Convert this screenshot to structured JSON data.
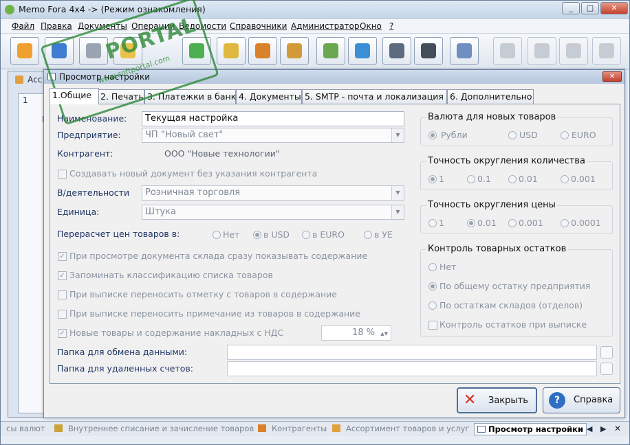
{
  "window": {
    "title": "Memo Fora 4x4 -> (Режим ознакомления)",
    "min": "_",
    "max": "□",
    "close": "✕"
  },
  "menu": [
    "Файл",
    "Правка",
    "Документы",
    "Операции",
    "Ведомости",
    "Справочники",
    "Администратор",
    "Окно",
    "?"
  ],
  "toolbar": {
    "icons": [
      "notes-icon",
      "card-icon",
      "printer-icon",
      "folder-icon",
      "download-icon",
      "scales-icon",
      "users-icon",
      "box-icon",
      "user-doc-icon",
      "chart-icon",
      "binoculars-icon",
      "headset-icon",
      "edit-icon",
      "tool1-icon",
      "tool2-icon",
      "tool3-icon",
      "tool4-icon"
    ]
  },
  "watermark": {
    "brand": "PORTAL",
    "url": "www.softportal.com"
  },
  "dialog": {
    "title": "Просмотр настройки",
    "close": "✕",
    "tabs": [
      "1.Общие",
      "2. Печать",
      "3. Платежки в банк",
      "4. Документы",
      "5. SMTP - почта и локализация",
      "6. Дополнительно"
    ],
    "fields": {
      "name_label": "Наименование:",
      "name_value": "Текущая настройка",
      "enterprise_label": "Предприятие:",
      "enterprise_value": "ЧП \"Новый свет\"",
      "contractor_label": "Контрагент:",
      "contractor_value": "ООО \"Новые технологии\"",
      "create_without_contractor": "Создавать новый документ без указания контрагента",
      "activity_label": "В/деятельности",
      "activity_value": "Розничная торговля",
      "unit_label": "Единица:",
      "unit_value": "Штука",
      "recalc_label": "Перерасчет цен товаров в:",
      "recalc_options": [
        "Нет",
        "в USD",
        "в EURO",
        "в УЕ"
      ],
      "opt1": "При просмотре документа склада сразу показывать содержание",
      "opt2": "Запоминать классификацию списка товаров",
      "opt3": "При выписке переносить отметку с товаров в содержание",
      "opt4": "При выписке переносить примечание из товаров в содержание",
      "opt5": "Новые товары и содержание накладных с НДС",
      "vat_value": "18 %",
      "exchange_folder_label": "Папка для обмена данными:",
      "deleted_folder_label": "Папка для удаленных счетов:"
    },
    "groups": {
      "currency": {
        "title": "Валюта для новых товаров",
        "options": [
          "Рубли",
          "USD",
          "EURO"
        ]
      },
      "qty_precision": {
        "title": "Точность округления количества",
        "options": [
          "1",
          "0.1",
          "0.01",
          "0.001"
        ]
      },
      "price_precision": {
        "title": "Точность округления цены",
        "options": [
          "1",
          "0.01",
          "0.001",
          "0.0001"
        ]
      },
      "stock_control": {
        "title": "Контроль товарных остатков",
        "options": [
          "Нет",
          "По общему остатку предприятия",
          "По остаткам складов (отделов)"
        ],
        "check": "Контроль остатков при выписке"
      }
    },
    "buttons": {
      "close": "Закрыть",
      "help": "Справка"
    }
  },
  "backwin": {
    "title": "Асс",
    "tab": "1",
    "col": "П"
  },
  "taskbar": [
    "сы валют",
    "Внутреннее списание и зачисление товаров",
    "Контрагенты",
    "Ассортимент товаров и услуг",
    "Просмотр настройки"
  ]
}
